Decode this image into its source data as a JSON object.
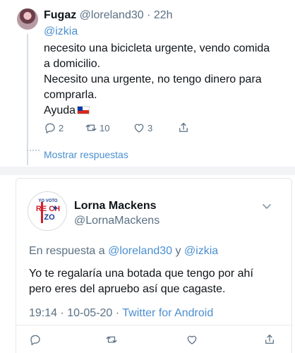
{
  "tweet": {
    "author_name": "Fugaz",
    "author_handle": "@loreland30",
    "separator": "·",
    "time": "22h",
    "mention": "@izkia",
    "text_lines": [
      "necesito una bicicleta urgente, vendo comida",
      "a domicilio.",
      "Necesito una urgente, no tengo dinero para",
      "comprarla.",
      "Ayuda"
    ],
    "flag_icon": "chile-flag-emoji",
    "actions": {
      "reply_icon": "reply-icon",
      "reply_count": "2",
      "retweet_icon": "retweet-icon",
      "retweet_count": "10",
      "like_icon": "heart-icon",
      "like_count": "3",
      "share_icon": "share-icon"
    },
    "show_replies": "Mostrar respuestas"
  },
  "reply": {
    "avatar_text_top": "YO VOTO",
    "avatar_text_mid": "RE CH",
    "avatar_text_bot": "ZO",
    "author_name": "Lorna Mackens",
    "author_handle": "@LornaMackens",
    "replying_prefix": "En respuesta a",
    "replying_mention1": "@loreland30",
    "replying_conj": "y",
    "replying_mention2": "@izkia",
    "text_lines": [
      "Yo te regalaría una botada que tengo por ahí",
      "pero eres del apruebo así que cagaste."
    ],
    "time": "19:14",
    "date": "10-05-20",
    "separator": "·",
    "source": "Twitter for Android"
  },
  "colors": {
    "link": "#4b8fd0",
    "muted": "#5b7083",
    "text": "#0f1419",
    "rechazo_red": "#d0202b",
    "rechazo_blue": "#1d3f8f"
  }
}
